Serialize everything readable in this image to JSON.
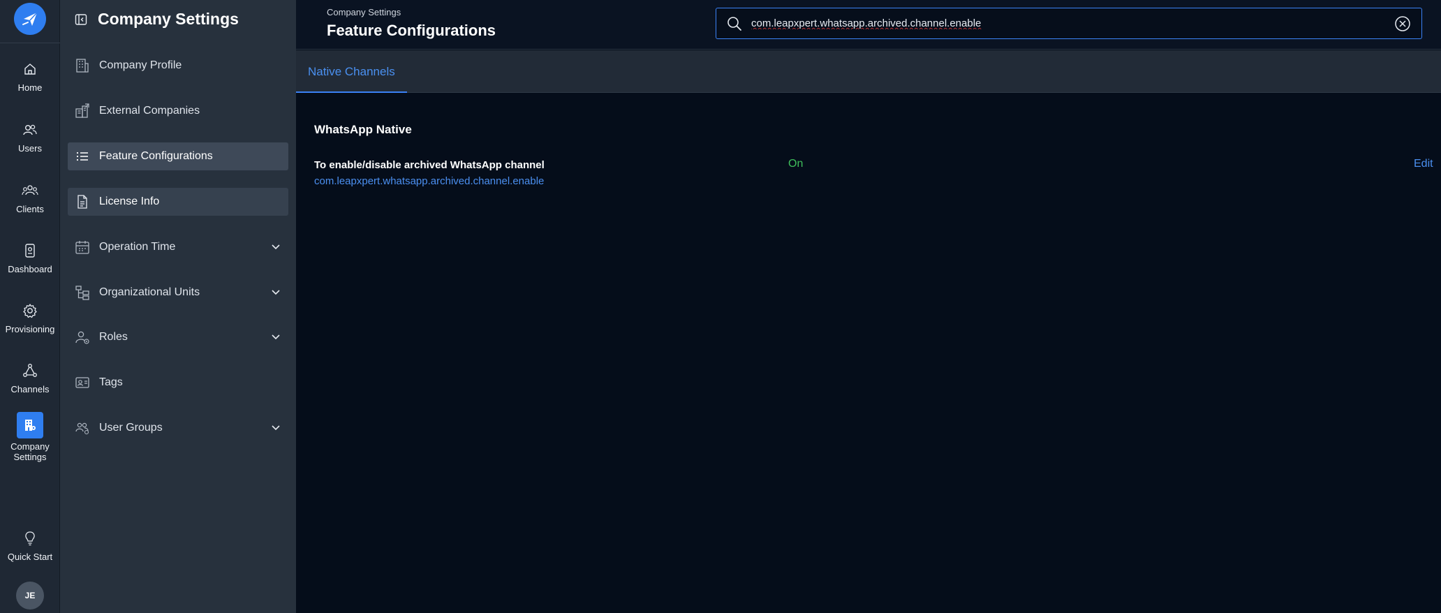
{
  "rail": {
    "items": [
      {
        "label": "Home",
        "icon": "home-icon"
      },
      {
        "label": "Users",
        "icon": "users-icon"
      },
      {
        "label": "Clients",
        "icon": "clients-icon"
      },
      {
        "label": "Dashboard",
        "icon": "dashboard-icon"
      },
      {
        "label": "Provisioning",
        "icon": "gear-icon"
      },
      {
        "label": "Channels",
        "icon": "channels-icon"
      },
      {
        "label": "Company Settings",
        "icon": "building-icon",
        "active": true
      },
      {
        "label": "Quick Start",
        "icon": "lightbulb-icon"
      }
    ],
    "avatar": "JE"
  },
  "panel": {
    "title": "Company Settings",
    "items": [
      {
        "label": "Company Profile",
        "icon": "building-icon"
      },
      {
        "label": "External Companies",
        "icon": "external-companies-icon"
      },
      {
        "label": "Feature Configurations",
        "icon": "list-icon",
        "active": true
      },
      {
        "label": "License Info",
        "icon": "document-icon"
      },
      {
        "label": "Operation Time",
        "icon": "calendar-icon",
        "expandable": true
      },
      {
        "label": "Organizational Units",
        "icon": "org-tree-icon",
        "expandable": true
      },
      {
        "label": "Roles",
        "icon": "user-role-icon",
        "expandable": true
      },
      {
        "label": "Tags",
        "icon": "tag-icon"
      },
      {
        "label": "User Groups",
        "icon": "user-groups-icon",
        "expandable": true
      }
    ]
  },
  "header": {
    "breadcrumb": "Company Settings",
    "title": "Feature Configurations"
  },
  "search": {
    "value": "com.leapxpert.whatsapp.archived.channel.enable"
  },
  "tabs": [
    {
      "label": "Native Channels",
      "active": true
    }
  ],
  "content": {
    "section_title": "WhatsApp Native",
    "config": {
      "label": "To enable/disable archived WhatsApp channel",
      "key": "com.leapxpert.whatsapp.archived.channel.enable",
      "status": "On",
      "edit_label": "Edit"
    }
  },
  "colors": {
    "accent": "#3b82f6",
    "status_on": "#3fbf5b",
    "link": "#4b8ff0"
  }
}
